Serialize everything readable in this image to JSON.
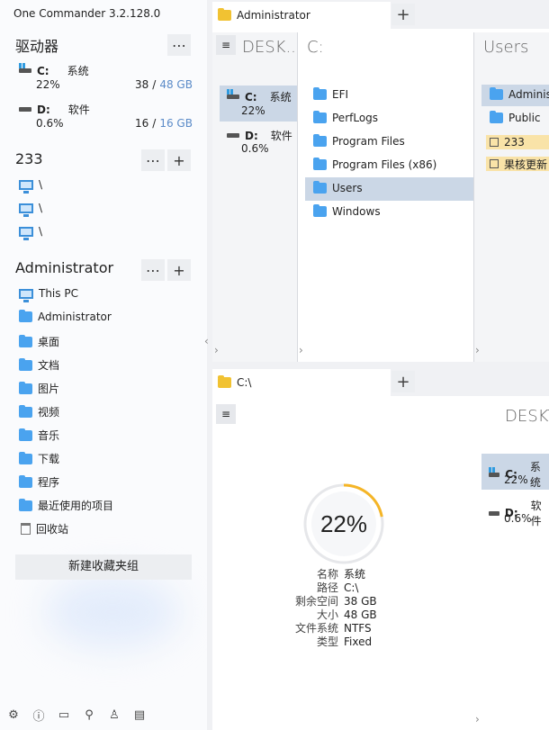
{
  "app": {
    "title": "One Commander 3.2.128.0"
  },
  "sidebar": {
    "drives_section": {
      "title": "驱动器",
      "more": "⋯",
      "drives": [
        {
          "letter": "C:",
          "label": "系统",
          "percent": "22%",
          "used": "38",
          "sep": "/",
          "total": "48 GB"
        },
        {
          "letter": "D:",
          "label": "软件",
          "percent": "0.6%",
          "used": "16",
          "sep": "/",
          "total": "16 GB"
        }
      ]
    },
    "group233": {
      "title": "233",
      "more": "⋯",
      "add": "+",
      "items": [
        "\\",
        "\\",
        "\\"
      ]
    },
    "admin_section": {
      "title": "Administrator",
      "more": "⋯",
      "add": "+",
      "items": [
        {
          "label": "This PC",
          "icon": "pc-icon"
        },
        {
          "label": "Administrator",
          "icon": "folder-icon"
        },
        {
          "label": "桌面",
          "icon": "folder-icon"
        },
        {
          "label": "文档",
          "icon": "folder-icon"
        },
        {
          "label": "图片",
          "icon": "folder-icon"
        },
        {
          "label": "视频",
          "icon": "folder-icon"
        },
        {
          "label": "音乐",
          "icon": "folder-icon"
        },
        {
          "label": "下载",
          "icon": "folder-icon"
        },
        {
          "label": "程序",
          "icon": "folder-icon"
        },
        {
          "label": "最近使用的项目",
          "icon": "folder-icon"
        },
        {
          "label": "回收站",
          "icon": "recycle-bin-icon"
        }
      ]
    },
    "new_group_label": "新建收藏夹组",
    "bottom_icons": [
      "gear-icon",
      "info-icon",
      "book-icon",
      "search-icon",
      "user-icon",
      "window-icon"
    ]
  },
  "top_pane": {
    "tab_label": "Administrator",
    "tab_add": "+",
    "col1": {
      "title": "DESK...",
      "hamburger": "≡",
      "drives": [
        {
          "letter": "C:",
          "label": "系统",
          "percent": "22%"
        },
        {
          "letter": "D:",
          "label": "软件",
          "percent": "0.6%"
        }
      ]
    },
    "col2": {
      "title": "C:",
      "folders": [
        "EFI",
        "PerfLogs",
        "Program Files",
        "Program Files (x86)",
        "Users",
        "Windows"
      ],
      "selected": "Users"
    },
    "col3": {
      "title": "Users",
      "folders": [
        "Adminis",
        "Public"
      ],
      "tags": [
        "233",
        "果核更新"
      ]
    }
  },
  "bottom_pane": {
    "tab_label": "C:\\",
    "tab_add": "+",
    "hamburger": "≡",
    "col_title": "DESKT",
    "drives": [
      {
        "letter": "C:",
        "label": "系统",
        "percent": "22%"
      },
      {
        "letter": "D:",
        "label": "软件",
        "percent": "0.6%"
      }
    ],
    "gauge": {
      "percent_text": "22%",
      "fraction": 0.22,
      "color": "#f5b526"
    },
    "props": [
      {
        "k": "名称",
        "v": "系统"
      },
      {
        "k": "路径",
        "v": "C:\\"
      },
      {
        "k": "剩余空间",
        "v": "38 GB"
      },
      {
        "k": "大小",
        "v": "48 GB"
      },
      {
        "k": "文件系统",
        "v": "NTFS"
      },
      {
        "k": "类型",
        "v": "Fixed"
      }
    ]
  },
  "colors": {
    "accent": "#4aa3ef",
    "selected": "#cbd7e6",
    "tag": "#f9e3a8"
  }
}
